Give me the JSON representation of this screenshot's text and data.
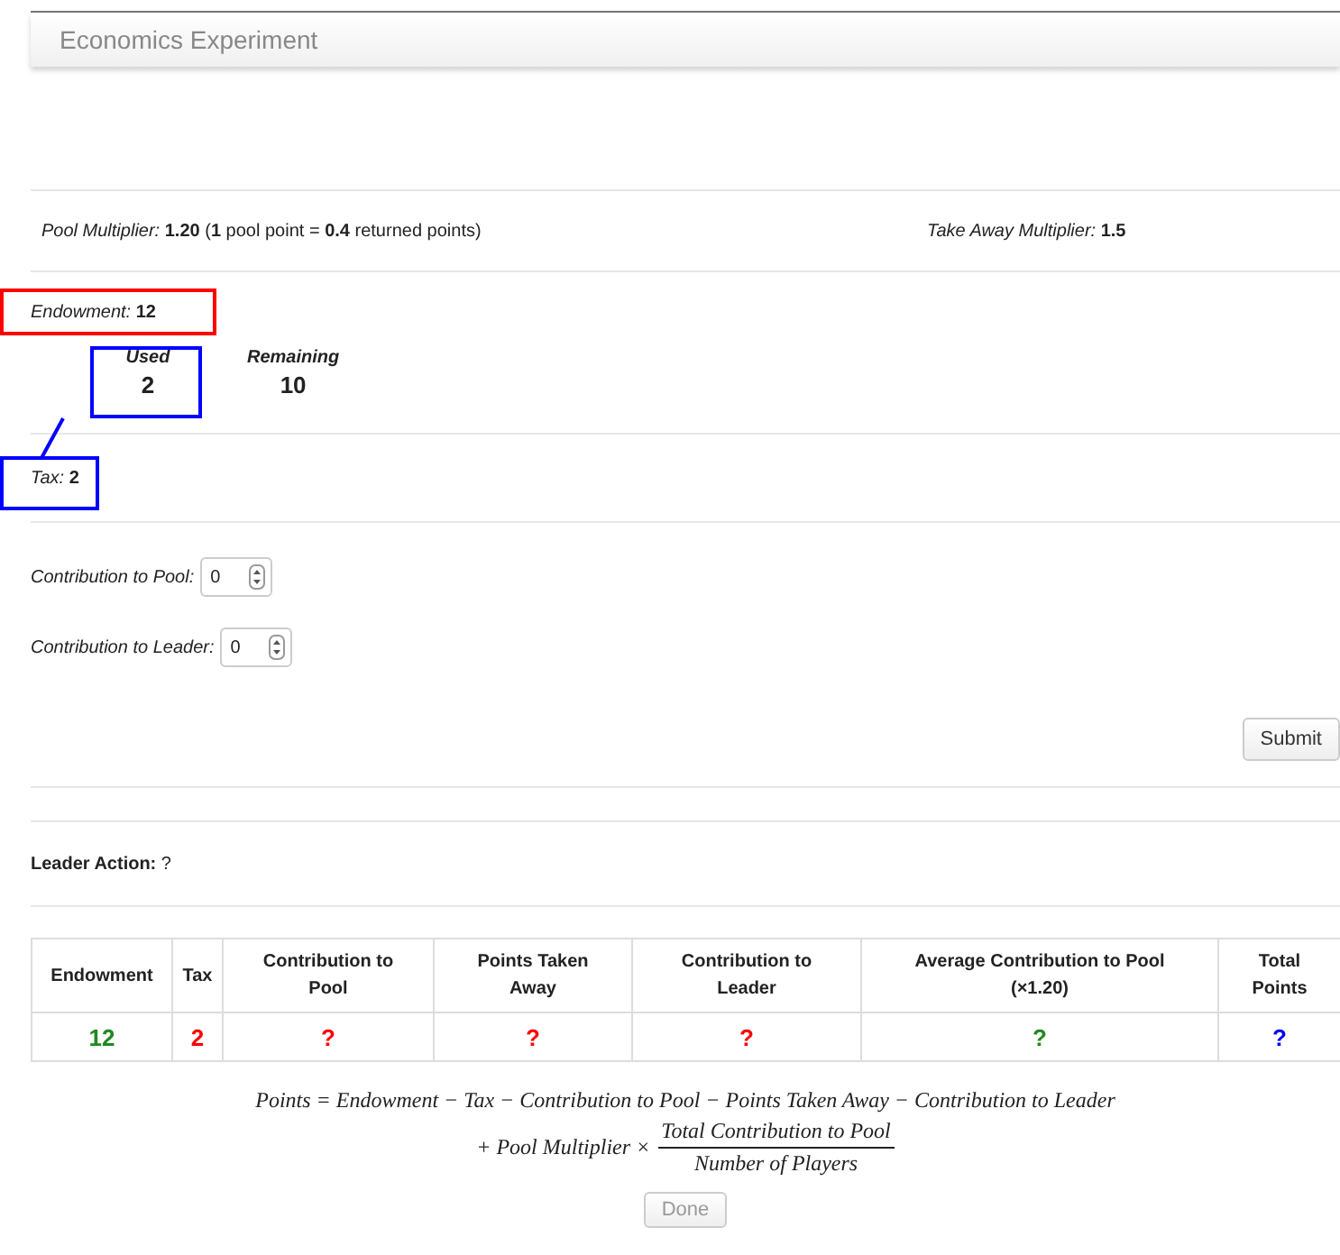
{
  "header": {
    "title": "Economics Experiment"
  },
  "multipliers": [
    {
      "label": "Pool Multiplier:",
      "value": "1.20",
      "note": "(**1** pool point = **0.4** returned points)"
    },
    {
      "label": "Take Away Multiplier:",
      "value": "1.5"
    }
  ],
  "endowment": {
    "label": "Endowment:",
    "value": "12"
  },
  "stats": [
    {
      "label": "Used",
      "value": "2"
    },
    {
      "label": "Remaining",
      "value": "10"
    }
  ],
  "tax": {
    "label": "Tax:",
    "value": "2"
  },
  "fields": [
    {
      "label": "Contribution to Pool:",
      "value": "0"
    },
    {
      "label": "Contribution to Leader:",
      "value": "0"
    }
  ],
  "submit_button": {
    "label": "Submit"
  },
  "leader_action": {
    "label": "Leader Action:",
    "value": "?"
  },
  "table": {
    "columns": [
      "Endowment",
      "Tax",
      "Contribution to Pool",
      "Points Taken Away",
      "Contribution to Leader",
      "Average Contribution to Pool (×1.20)",
      "Total Points"
    ],
    "row": [
      {
        "text": "12",
        "color": "#1e8a1e"
      },
      {
        "text": "2",
        "color": "#ff0000"
      },
      {
        "text": "?",
        "color": "#ff0000"
      },
      {
        "text": "?",
        "color": "#ff0000"
      },
      {
        "text": "?",
        "color": "#ff0000"
      },
      {
        "text": "?",
        "color": "#1e8a1e"
      },
      {
        "text": "?",
        "color": "#0000ff"
      }
    ]
  },
  "formula": {
    "line1": "Points = Endowment − Tax − Contribution to Pool − Points Taken Away − Contribution to Leader",
    "line2": "+ Pool Multiplier ×",
    "numerator": "Total Contribution to Pool",
    "denominator": "Number of Players"
  },
  "done_button": {
    "label": "Done",
    "disabled": true
  },
  "annotations": [
    {
      "kind": "box",
      "color": "#ff0000"
    },
    {
      "kind": "box",
      "color": "#0000ff"
    },
    {
      "kind": "box",
      "color": "#0000ff"
    },
    {
      "kind": "line",
      "color": "#0000ff"
    }
  ]
}
